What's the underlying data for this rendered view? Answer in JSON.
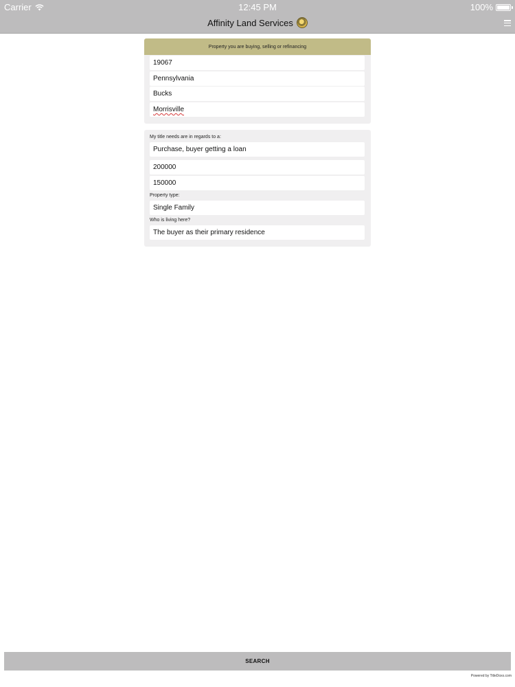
{
  "status_bar": {
    "carrier": "Carrier",
    "time": "12:45 PM",
    "battery": "100%",
    "icons": [
      "wifi-icon",
      "battery-icon"
    ]
  },
  "nav_bar": {
    "title": "Affinity Land Services",
    "icons": [
      "logo-icon",
      "menu-icon"
    ]
  },
  "property_section": {
    "header": "Property you are buying, selling or refinancing",
    "zip": "19067",
    "state": "Pennsylvania",
    "county": "Bucks",
    "city": "Morrisville"
  },
  "title_section": {
    "needs_label": "My title needs are in regards to a:",
    "needs_value": "Purchase, buyer getting a loan",
    "price": "200000",
    "loan_amount": "150000",
    "property_type_label": "Property type:",
    "property_type_value": "Single Family",
    "occupancy_label": "Who is living here?",
    "occupancy_value": "The buyer as their primary residence"
  },
  "footer": {
    "search_label": "SEARCH",
    "powered_by": "Powered by TitleDoxx.com"
  },
  "colors": {
    "bar_gray": "#bdbcbd",
    "header_khaki": "#c1bb87",
    "panel_bg": "#f0eff0"
  }
}
